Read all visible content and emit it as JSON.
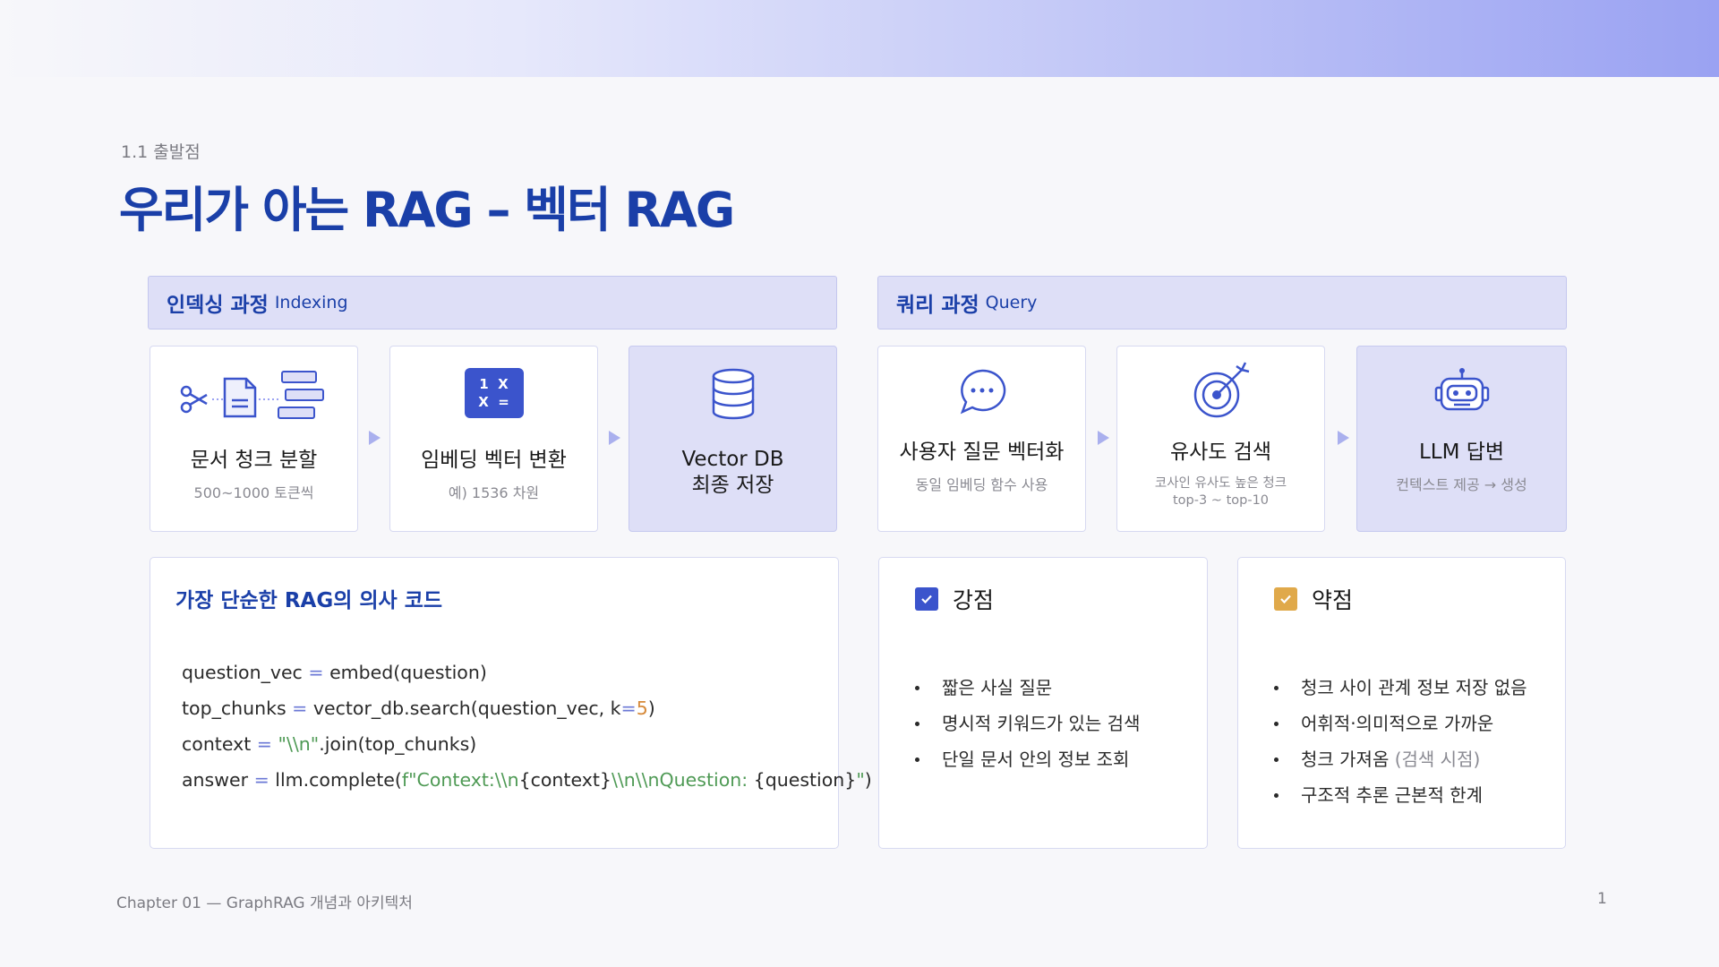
{
  "section": "1.1 출발점",
  "title": "우리가 아는 RAG – 벡터 RAG",
  "indexing": {
    "label": "인덱싱 과정",
    "label_en": "Indexing",
    "steps": [
      {
        "title": "문서 청크 분할",
        "sub": "500~1000 토큰씩",
        "icon": "document-split-icon"
      },
      {
        "title": "임베딩 벡터 변환",
        "sub": "예) 1536 차원",
        "icon": "matrix-icon",
        "icon_text": [
          "1  X",
          "X  ="
        ]
      },
      {
        "title_lines": [
          "Vector DB",
          "최종 저장"
        ],
        "icon": "database-icon"
      }
    ]
  },
  "query": {
    "label": "쿼리 과정",
    "label_en": "Query",
    "steps": [
      {
        "title": "사용자 질문 벡터화",
        "sub": "동일 임베딩 함수 사용",
        "icon": "chat-bubble-icon"
      },
      {
        "title": "유사도 검색",
        "sub_lines": [
          "코사인 유사도 높은 청크",
          "top-3 ~ top-10"
        ],
        "icon": "target-icon"
      },
      {
        "title": "LLM 답변",
        "sub": "컨텍스트 제공 → 생성",
        "icon": "robot-icon"
      }
    ]
  },
  "code_card": {
    "title": "가장 단순한 RAG의 의사 코드"
  },
  "strengths": {
    "title": "강점",
    "items": [
      "짧은 사실 질문",
      "명시적 키워드가 있는 검색",
      "단일 문서 안의 정보 조회"
    ]
  },
  "weaknesses": {
    "title": "약점",
    "items": [
      "청크 사이 관계 정보 저장 없음",
      "어휘적·의미적으로 가까운",
      "청크 가져옴",
      "구조적 추론 근본적 한계"
    ],
    "item3_note": "(검색 시점)"
  },
  "footer": {
    "left": "Chapter 01 — GraphRAG 개념과 아키텍처",
    "page": "1"
  },
  "colors": {
    "accent": "#1a3fa8",
    "panel": "#dedff7",
    "check_pro": "#3b54cc",
    "check_con": "#e0a94a"
  }
}
